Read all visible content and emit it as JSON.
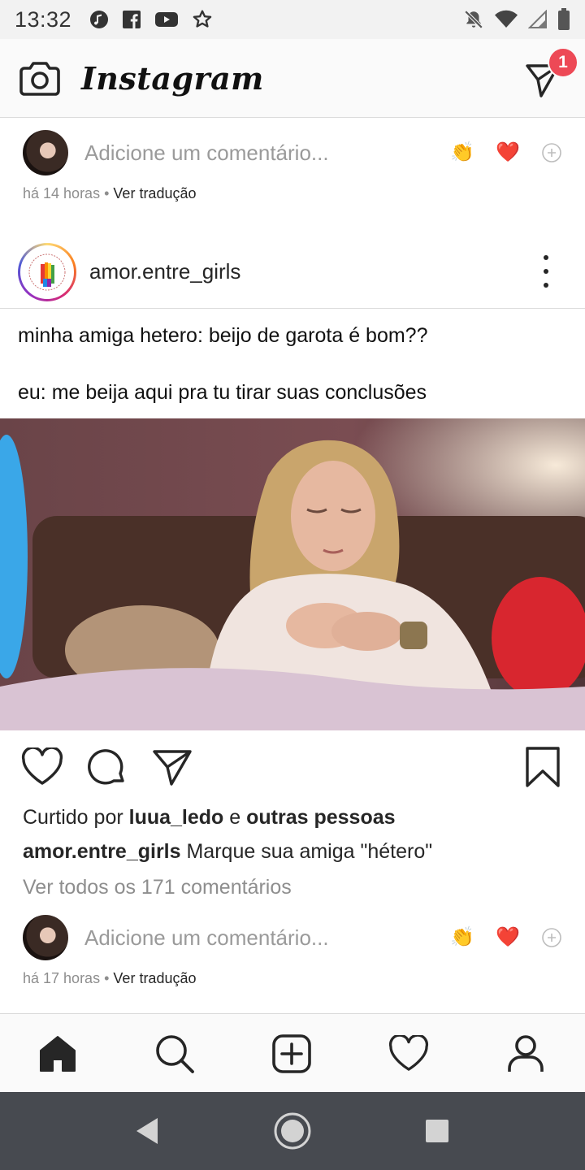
{
  "status_bar": {
    "time": "13:32"
  },
  "header": {
    "app_name": "Instagram",
    "dm_badge_count": "1"
  },
  "prev_post_footer": {
    "comment_placeholder": "Adicione um comentário...",
    "time": "há 14 horas",
    "separator": "•",
    "translate": "Ver tradução"
  },
  "post": {
    "username": "amor.entre_girls",
    "meme_text_line1": "minha amiga hetero: beijo de garota é bom??",
    "meme_text_line2": "eu: me beija aqui pra tu tirar suas conclusões",
    "liked_by_prefix": "Curtido por",
    "liked_by_user": "luua_ledo",
    "liked_by_join": "e",
    "liked_by_others": "outras pessoas",
    "caption_user": "amor.entre_girls",
    "caption_text": "Marque sua amiga \"hétero\"",
    "view_comments": "Ver todos os 171 comentários",
    "comment_placeholder": "Adicione um comentário...",
    "time": "há 17 horas",
    "separator": "•",
    "translate": "Ver tradução"
  },
  "quick_reactions": {
    "clap": "👏",
    "heart": "❤️"
  },
  "colors": {
    "accent_red": "#ed4956",
    "text": "#262626",
    "muted": "#8e8e8e",
    "system_nav_bg": "#474a50"
  },
  "icons": {
    "status": [
      "music-icon",
      "facebook-icon",
      "youtube-icon",
      "star-icon",
      "mute-icon",
      "wifi-icon",
      "signal-icon",
      "battery-icon"
    ],
    "header": [
      "camera-icon",
      "direct-message-icon"
    ],
    "post_actions": [
      "like-icon",
      "comment-icon",
      "share-icon",
      "bookmark-icon"
    ],
    "bottom_nav": [
      "home-icon",
      "search-icon",
      "new-post-icon",
      "activity-icon",
      "profile-icon"
    ],
    "system_nav": [
      "back-icon",
      "home-circle-icon",
      "recents-icon"
    ]
  }
}
